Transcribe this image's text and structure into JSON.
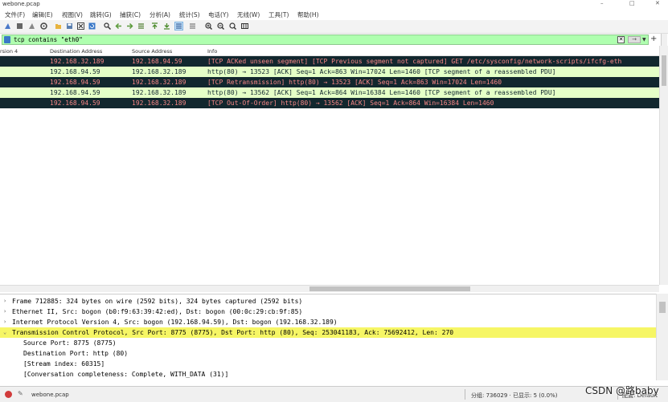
{
  "window": {
    "title": "webone.pcap",
    "controls": [
      "–",
      "□",
      "✕"
    ]
  },
  "menu": [
    "文件(F)",
    "编辑(E)",
    "视图(V)",
    "跳转(G)",
    "捕获(C)",
    "分析(A)",
    "统计(S)",
    "电话(Y)",
    "无线(W)",
    "工具(T)",
    "帮助(H)"
  ],
  "toolbar": {
    "icons": [
      "fin-icon",
      "stop-icon",
      "restart-icon",
      "options-icon",
      "open-icon",
      "save-icon",
      "close-file-icon",
      "reload-icon",
      "find-icon",
      "back-icon",
      "forward-icon",
      "goto-icon",
      "first-icon",
      "last-icon",
      "autoscroll-icon",
      "colorize-icon",
      "zoom-in-icon",
      "zoom-out-icon",
      "zoom-normal-icon",
      "resize-columns-icon"
    ]
  },
  "filter": {
    "value": "tcp contains \"eth0\"",
    "plus": "+"
  },
  "packet_list": {
    "columns": [
      "rsion 4",
      "Destination Address",
      "Source Address",
      "Info"
    ],
    "rows": [
      {
        "style": "bad",
        "dst": "192.168.32.189",
        "src": "192.168.94.59",
        "info": "[TCP ACKed unseen segment] [TCP Previous segment not captured] GET /etc/sysconfig/network-scripts/ifcfg-eth"
      },
      {
        "style": "ok",
        "dst": "192.168.94.59",
        "src": "192.168.32.189",
        "info": "http(80) → 13523 [ACK] Seq=1 Ack=863 Win=17024 Len=1460 [TCP segment of a reassembled PDU]"
      },
      {
        "style": "bad",
        "dst": "192.168.94.59",
        "src": "192.168.32.189",
        "info": "[TCP Retransmission] http(80) → 13523 [ACK] Seq=1 Ack=863 Win=17024 Len=1460"
      },
      {
        "style": "ok",
        "dst": "192.168.94.59",
        "src": "192.168.32.189",
        "info": "http(80) → 13562 [ACK] Seq=1 Ack=864 Win=16384 Len=1460 [TCP segment of a reassembled PDU]"
      },
      {
        "style": "bad",
        "dst": "192.168.94.59",
        "src": "192.168.32.189",
        "info": "[TCP Out-Of-Order] http(80) → 13562 [ACK] Seq=1 Ack=864 Win=16384 Len=1460"
      }
    ]
  },
  "details": [
    {
      "arrow": "›",
      "text": "Frame 712885: 324 bytes on wire (2592 bits), 324 bytes captured (2592 bits)",
      "selected": false,
      "child": false
    },
    {
      "arrow": "›",
      "text": "Ethernet II, Src: bogon (b0:f9:63:39:42:ed), Dst: bogon (00:0c:29:cb:9f:85)",
      "selected": false,
      "child": false
    },
    {
      "arrow": "›",
      "text": "Internet Protocol Version 4, Src: bogon (192.168.94.59), Dst: bogon (192.168.32.189)",
      "selected": false,
      "child": false
    },
    {
      "arrow": "⌄",
      "text": "Transmission Control Protocol, Src Port: 8775 (8775), Dst Port: http (80), Seq: 253041183, Ack: 75692412, Len: 270",
      "selected": true,
      "child": false
    },
    {
      "arrow": "",
      "text": "Source Port: 8775 (8775)",
      "selected": false,
      "child": true
    },
    {
      "arrow": "",
      "text": "Destination Port: http (80)",
      "selected": false,
      "child": true
    },
    {
      "arrow": "",
      "text": "[Stream index: 60315]",
      "selected": false,
      "child": true
    },
    {
      "arrow": "",
      "text": "[Conversation completeness: Complete, WITH_DATA (31)]",
      "selected": false,
      "child": true
    }
  ],
  "status": {
    "file": "webone.pcap",
    "packets": "分组: 736029 · 已显示: 5 (0.0%)",
    "profile": "配置: Default",
    "watermark": "CSDN @路baby"
  },
  "colors": {
    "bad_bg": "#12272e",
    "bad_fg": "#f78787",
    "ok_bg": "#e4ffc7",
    "filter_bg": "#afffaf",
    "selected": "#f6f665"
  }
}
